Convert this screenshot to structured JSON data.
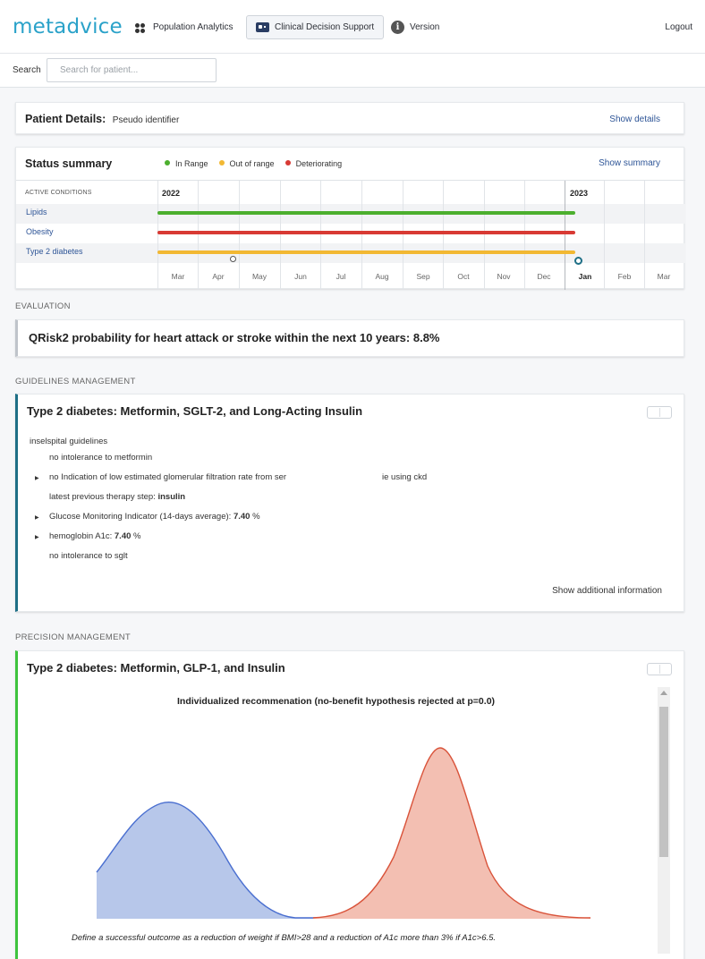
{
  "brand": {
    "logo_text": "metadvice",
    "accent": "#2aa2c9"
  },
  "nav": {
    "population_analytics": "Population Analytics",
    "clinical_decision_support": "Clinical Decision Support",
    "version": "Version",
    "logout": "Logout",
    "active_tab": "Clinical Decision Support"
  },
  "search": {
    "label": "Search",
    "placeholder": "Search for patient..."
  },
  "patient_details": {
    "title": "Patient Details:",
    "identifier": "Pseudo identifier",
    "link": "Show details"
  },
  "status_summary": {
    "title": "Status summary",
    "legend": [
      {
        "label": "In Range",
        "color": "#4caf2e"
      },
      {
        "label": "Out of range",
        "color": "#f2b833"
      },
      {
        "label": "Deteriorating",
        "color": "#d83a34"
      }
    ],
    "link": "Show summary",
    "active_conditions_header": "ACTIVE CONDITIONS",
    "conditions": [
      {
        "name": "Lipids",
        "status_color": "#4caf2e"
      },
      {
        "name": "Obesity",
        "status_color": "#d83a34"
      },
      {
        "name": "Type 2 diabetes",
        "status_color": "#f2b833"
      }
    ],
    "years": [
      "2022",
      "2023"
    ],
    "months": [
      "Mar",
      "Apr",
      "May",
      "Jun",
      "Jul",
      "Aug",
      "Sep",
      "Oct",
      "Nov",
      "Dec",
      "Jan",
      "Feb",
      "Mar"
    ]
  },
  "evaluation": {
    "section_label": "EVALUATION",
    "text": "QRisk2 probability for heart attack or stroke within the next 10 years: 8.8%"
  },
  "guidelines": {
    "section_label": "GUIDELINES MANAGEMENT",
    "title": "Type 2 diabetes: Metformin, SGLT-2, and Long-Acting Insulin",
    "source": "inselspital guidelines",
    "items": {
      "i1": "no intolerance to metformin",
      "i2a": "no Indication of low estimated glomerular filtration rate from ser",
      "i2b": "ie using ckd",
      "i3_prefix": "latest previous therapy step: ",
      "i3_value": "insulin",
      "i4_prefix": "Glucose Monitoring Indicator (14-days average): ",
      "i4_value": "7.40",
      "i4_unit": " %",
      "i5_prefix": "hemoglobin A1c: ",
      "i5_value": "7.40",
      "i5_unit": " %",
      "i6": "no intolerance to sglt"
    },
    "more_link": "Show additional information"
  },
  "precision": {
    "section_label": "PRECISION MANAGEMENT",
    "title": "Type 2 diabetes: Metformin, GLP-1, and Insulin",
    "plot_title": "Individualized recommenation (no-benefit hypothesis rejected at p=0.0)",
    "caption": "Define a successful outcome as a reduction of weight if BMI>28 and a reduction of A1c more than 3% if A1c>6.5.",
    "colors": {
      "blue_fill": "#b7c7ea",
      "blue_line": "#4a6fd0",
      "red_fill": "#f3bfb2",
      "red_line": "#d9533a"
    }
  }
}
